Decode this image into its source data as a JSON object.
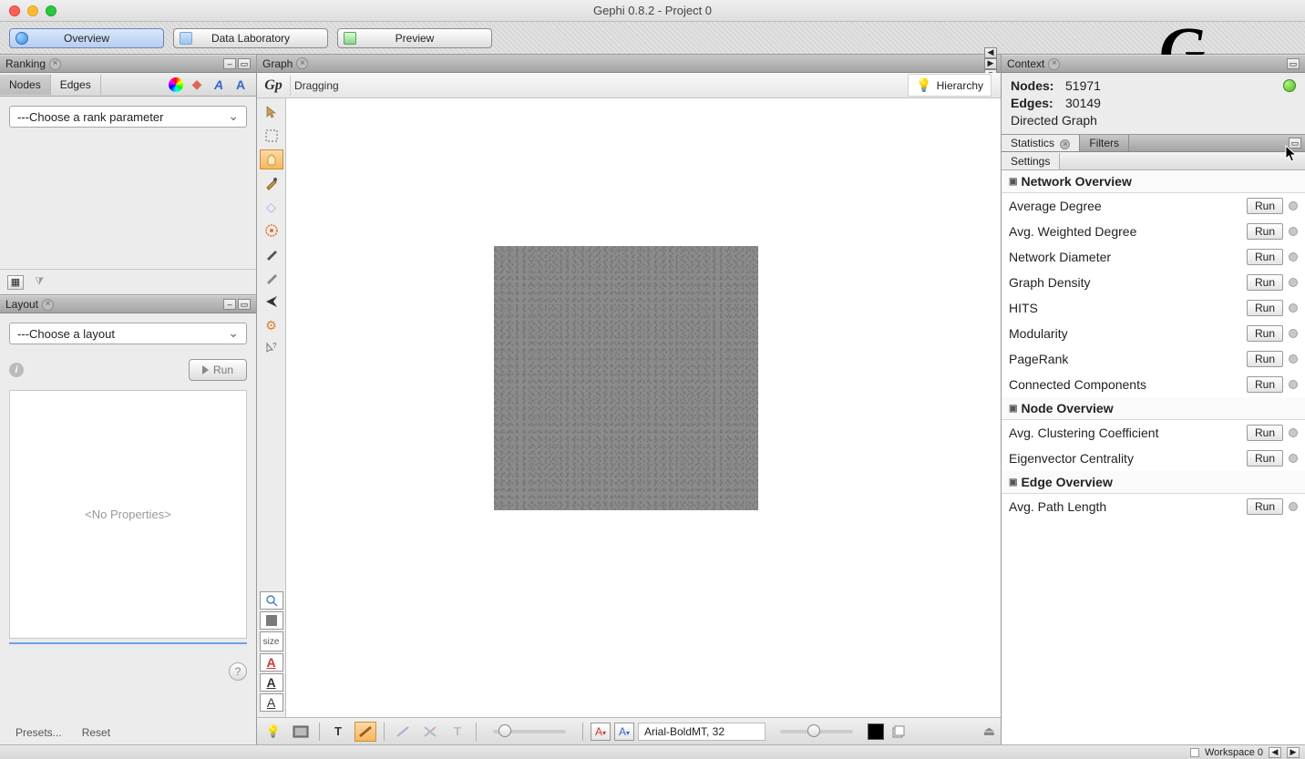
{
  "title": "Gephi 0.8.2 - Project 0",
  "main_tabs": {
    "overview": "Overview",
    "data_lab": "Data Laboratory",
    "preview": "Preview"
  },
  "ranking": {
    "panel_title": "Ranking",
    "tab_nodes": "Nodes",
    "tab_edges": "Edges",
    "dropdown": "---Choose a rank parameter"
  },
  "layout": {
    "panel_title": "Layout",
    "dropdown": "---Choose a layout",
    "run": "Run",
    "no_props": "<No Properties>",
    "presets": "Presets...",
    "reset": "Reset"
  },
  "graph": {
    "tab": "Graph",
    "mode": "Dragging",
    "hierarchy": "Hierarchy",
    "size_label": "size",
    "font": "Arial-BoldMT, 32"
  },
  "context": {
    "panel_title": "Context",
    "nodes_label": "Nodes:",
    "nodes_value": "51971",
    "edges_label": "Edges:",
    "edges_value": "30149",
    "graph_type": "Directed Graph"
  },
  "stats": {
    "tab_statistics": "Statistics",
    "tab_filters": "Filters",
    "settings": "Settings",
    "run_label": "Run",
    "sections": {
      "network": "Network Overview",
      "node": "Node Overview",
      "edge": "Edge Overview"
    },
    "items": {
      "avg_degree": "Average Degree",
      "avg_weighted_degree": "Avg. Weighted Degree",
      "network_diameter": "Network Diameter",
      "graph_density": "Graph Density",
      "hits": "HITS",
      "modularity": "Modularity",
      "pagerank": "PageRank",
      "connected_components": "Connected Components",
      "avg_clustering": "Avg. Clustering Coefficient",
      "eigenvector": "Eigenvector Centrality",
      "avg_path_length": "Avg. Path Length"
    }
  },
  "footer": {
    "workspace": "Workspace 0"
  }
}
